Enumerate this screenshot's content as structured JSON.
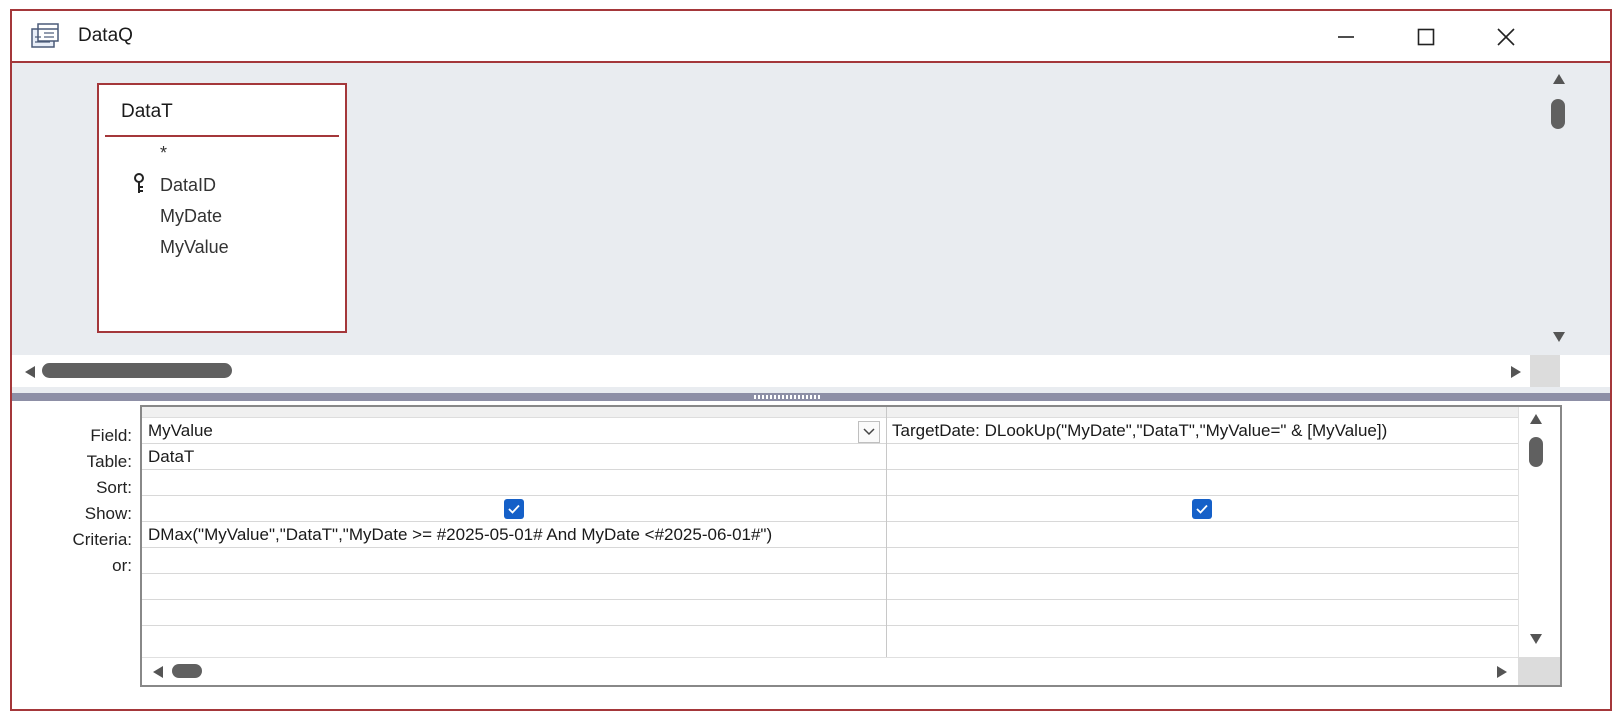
{
  "window": {
    "title": "DataQ",
    "minimize_icon": "minimize-icon",
    "maximize_icon": "maximize-icon",
    "close_icon": "close-icon"
  },
  "table_box": {
    "name": "DataT",
    "fields": [
      "*",
      "DataID",
      "MyDate",
      "MyValue"
    ],
    "primary_key": "DataID"
  },
  "grid": {
    "row_labels": [
      "Field:",
      "Table:",
      "Sort:",
      "Show:",
      "Criteria:",
      "or:"
    ],
    "columns": [
      {
        "field": "MyValue",
        "table": "DataT",
        "sort": "",
        "show": true,
        "criteria": "DMax(\"MyValue\",\"DataT\",\"MyDate >= #2025-05-01# And MyDate <#2025-06-01#\")",
        "or": ""
      },
      {
        "field": "TargetDate: DLookUp(\"MyDate\",\"DataT\",\"MyValue=\" & [MyValue])",
        "table": "",
        "sort": "",
        "show": true,
        "criteria": "",
        "or": ""
      }
    ]
  },
  "colors": {
    "accent": "#a4373a",
    "checkbox": "#1560c8",
    "pane_bg": "#e9ecf0",
    "splitter": "#8d8fa6"
  }
}
